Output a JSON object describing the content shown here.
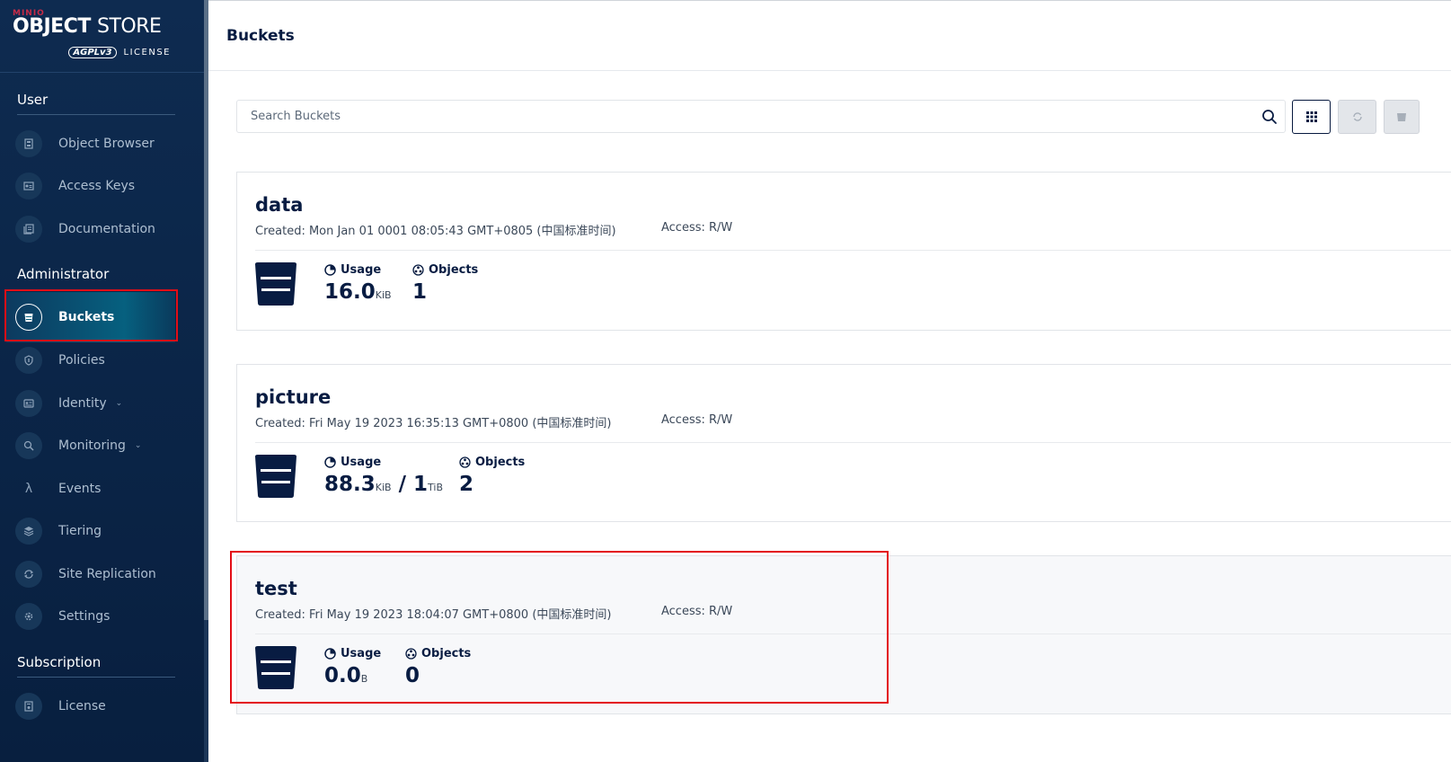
{
  "logo": {
    "brand": "MINIO",
    "product_bold": "OBJECT",
    "product_light": "STORE",
    "license_badge": "AGPLv3",
    "license_text": "LICENSE"
  },
  "sidebar": {
    "sections": {
      "user": "User",
      "administrator": "Administrator",
      "subscription": "Subscription"
    },
    "items": [
      {
        "label": "Object Browser",
        "icon": "object-browser-icon"
      },
      {
        "label": "Access Keys",
        "icon": "access-keys-icon"
      },
      {
        "label": "Documentation",
        "icon": "documentation-icon"
      },
      {
        "label": "Buckets",
        "icon": "bucket-icon",
        "active": true
      },
      {
        "label": "Policies",
        "icon": "policies-icon"
      },
      {
        "label": "Identity",
        "icon": "identity-icon",
        "expandable": true
      },
      {
        "label": "Monitoring",
        "icon": "monitoring-icon",
        "expandable": true
      },
      {
        "label": "Events",
        "icon": "lambda-icon"
      },
      {
        "label": "Tiering",
        "icon": "tiering-icon"
      },
      {
        "label": "Site Replication",
        "icon": "replication-icon"
      },
      {
        "label": "Settings",
        "icon": "gear-icon"
      },
      {
        "label": "License",
        "icon": "license-icon"
      }
    ]
  },
  "page": {
    "title": "Buckets"
  },
  "search": {
    "placeholder": "Search Buckets",
    "value": ""
  },
  "buckets": [
    {
      "name": "data",
      "created": "Created: Mon Jan 01 0001 08:05:43 GMT+0805 (中国标准时间)",
      "access": "Access: R/W",
      "usage_label": "Usage",
      "usage_value": "16.0",
      "usage_unit": "KiB",
      "quota_sep": "",
      "quota_value": "",
      "quota_unit": "",
      "objects_label": "Objects",
      "objects_value": "1"
    },
    {
      "name": "picture",
      "created": "Created: Fri May 19 2023 16:35:13 GMT+0800 (中国标准时间)",
      "access": "Access: R/W",
      "usage_label": "Usage",
      "usage_value": "88.3",
      "usage_unit": "KiB",
      "quota_sep": " / ",
      "quota_value": "1",
      "quota_unit": "TiB",
      "objects_label": "Objects",
      "objects_value": "2"
    },
    {
      "name": "test",
      "created": "Created: Fri May 19 2023 18:04:07 GMT+0800 (中国标准时间)",
      "access": "Access: R/W",
      "usage_label": "Usage",
      "usage_value": "0.0",
      "usage_unit": "B",
      "quota_sep": "",
      "quota_value": "",
      "quota_unit": "",
      "objects_label": "Objects",
      "objects_value": "0"
    }
  ],
  "colors": {
    "sidebar_bg": "#0e2b50",
    "accent_navy": "#081c42",
    "highlight_red": "#e30e16"
  }
}
